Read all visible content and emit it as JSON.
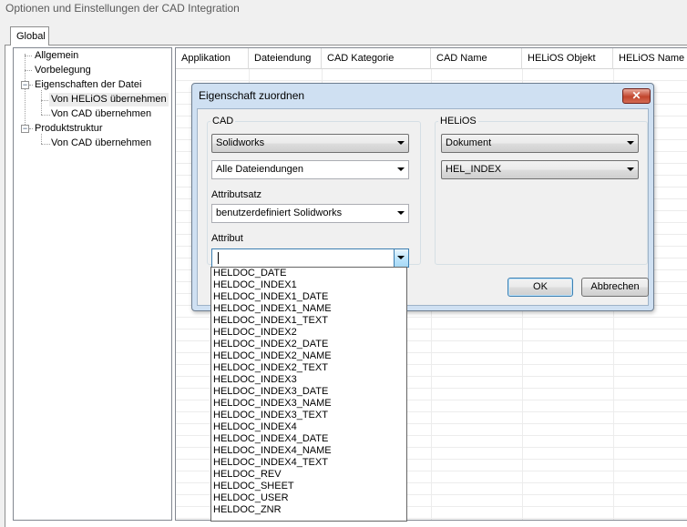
{
  "window": {
    "title": "Optionen und Einstellungen der CAD Integration"
  },
  "tabs": [
    {
      "label": "Global"
    }
  ],
  "tree": {
    "items": [
      {
        "label": "Allgemein"
      },
      {
        "label": "Vorbelegung"
      },
      {
        "label": "Eigenschaften der Datei"
      },
      {
        "label": "Von HELiOS übernehmen"
      },
      {
        "label": "Von CAD übernehmen"
      },
      {
        "label": "Produktstruktur"
      },
      {
        "label": "Von CAD übernehmen"
      }
    ]
  },
  "grid": {
    "columns": [
      "Applikation",
      "Dateiendung",
      "CAD Kategorie",
      "CAD Name",
      "HELiOS Objekt",
      "HELiOS Name"
    ]
  },
  "dialog": {
    "title": "Eigenschaft zuordnen",
    "close_label": "✕",
    "cad_group_label": "CAD",
    "cad_app": "Solidworks",
    "file_ext": "Alle Dateiendungen",
    "attribute_set_label": "Attributsatz",
    "attribute_set": "benutzerdefiniert Solidworks",
    "attribute_label": "Attribut",
    "attribute_value": "",
    "helios_group_label": "HELiOS",
    "helios_object": "Dokument",
    "helios_attribute": "HEL_INDEX",
    "ok_label": "OK",
    "cancel_label": "Abbrechen"
  },
  "dropdown": {
    "options": [
      "HELDOC_DATE",
      "HELDOC_INDEX1",
      "HELDOC_INDEX1_DATE",
      "HELDOC_INDEX1_NAME",
      "HELDOC_INDEX1_TEXT",
      "HELDOC_INDEX2",
      "HELDOC_INDEX2_DATE",
      "HELDOC_INDEX2_NAME",
      "HELDOC_INDEX2_TEXT",
      "HELDOC_INDEX3",
      "HELDOC_INDEX3_DATE",
      "HELDOC_INDEX3_NAME",
      "HELDOC_INDEX3_TEXT",
      "HELDOC_INDEX4",
      "HELDOC_INDEX4_DATE",
      "HELDOC_INDEX4_NAME",
      "HELDOC_INDEX4_TEXT",
      "HELDOC_REV",
      "HELDOC_SHEET",
      "HELDOC_USER",
      "HELDOC_ZNR"
    ]
  }
}
